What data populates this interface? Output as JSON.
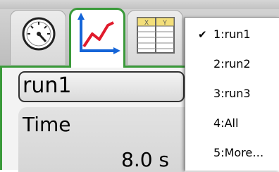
{
  "tabs": [
    {
      "name": "meter",
      "icon": "gauge-icon"
    },
    {
      "name": "graph",
      "icon": "graph-icon",
      "active": true
    },
    {
      "name": "table",
      "icon": "table-icon",
      "header": [
        "X",
        "Y"
      ]
    }
  ],
  "run_selector": {
    "label": "run1"
  },
  "meter": {
    "name": "Time",
    "value": "8.0 s"
  },
  "menu": {
    "items": [
      {
        "label": "1:run1",
        "checked": true
      },
      {
        "label": "2:run2",
        "checked": false
      },
      {
        "label": "3:run3",
        "checked": false
      },
      {
        "label": "4:All",
        "checked": false
      },
      {
        "label": "5:More…",
        "checked": false
      }
    ],
    "check_glyph": "✔"
  },
  "colors": {
    "accent_green": "#3a9a3a",
    "graph_blue": "#1565d8",
    "graph_red": "#e01b2c"
  }
}
